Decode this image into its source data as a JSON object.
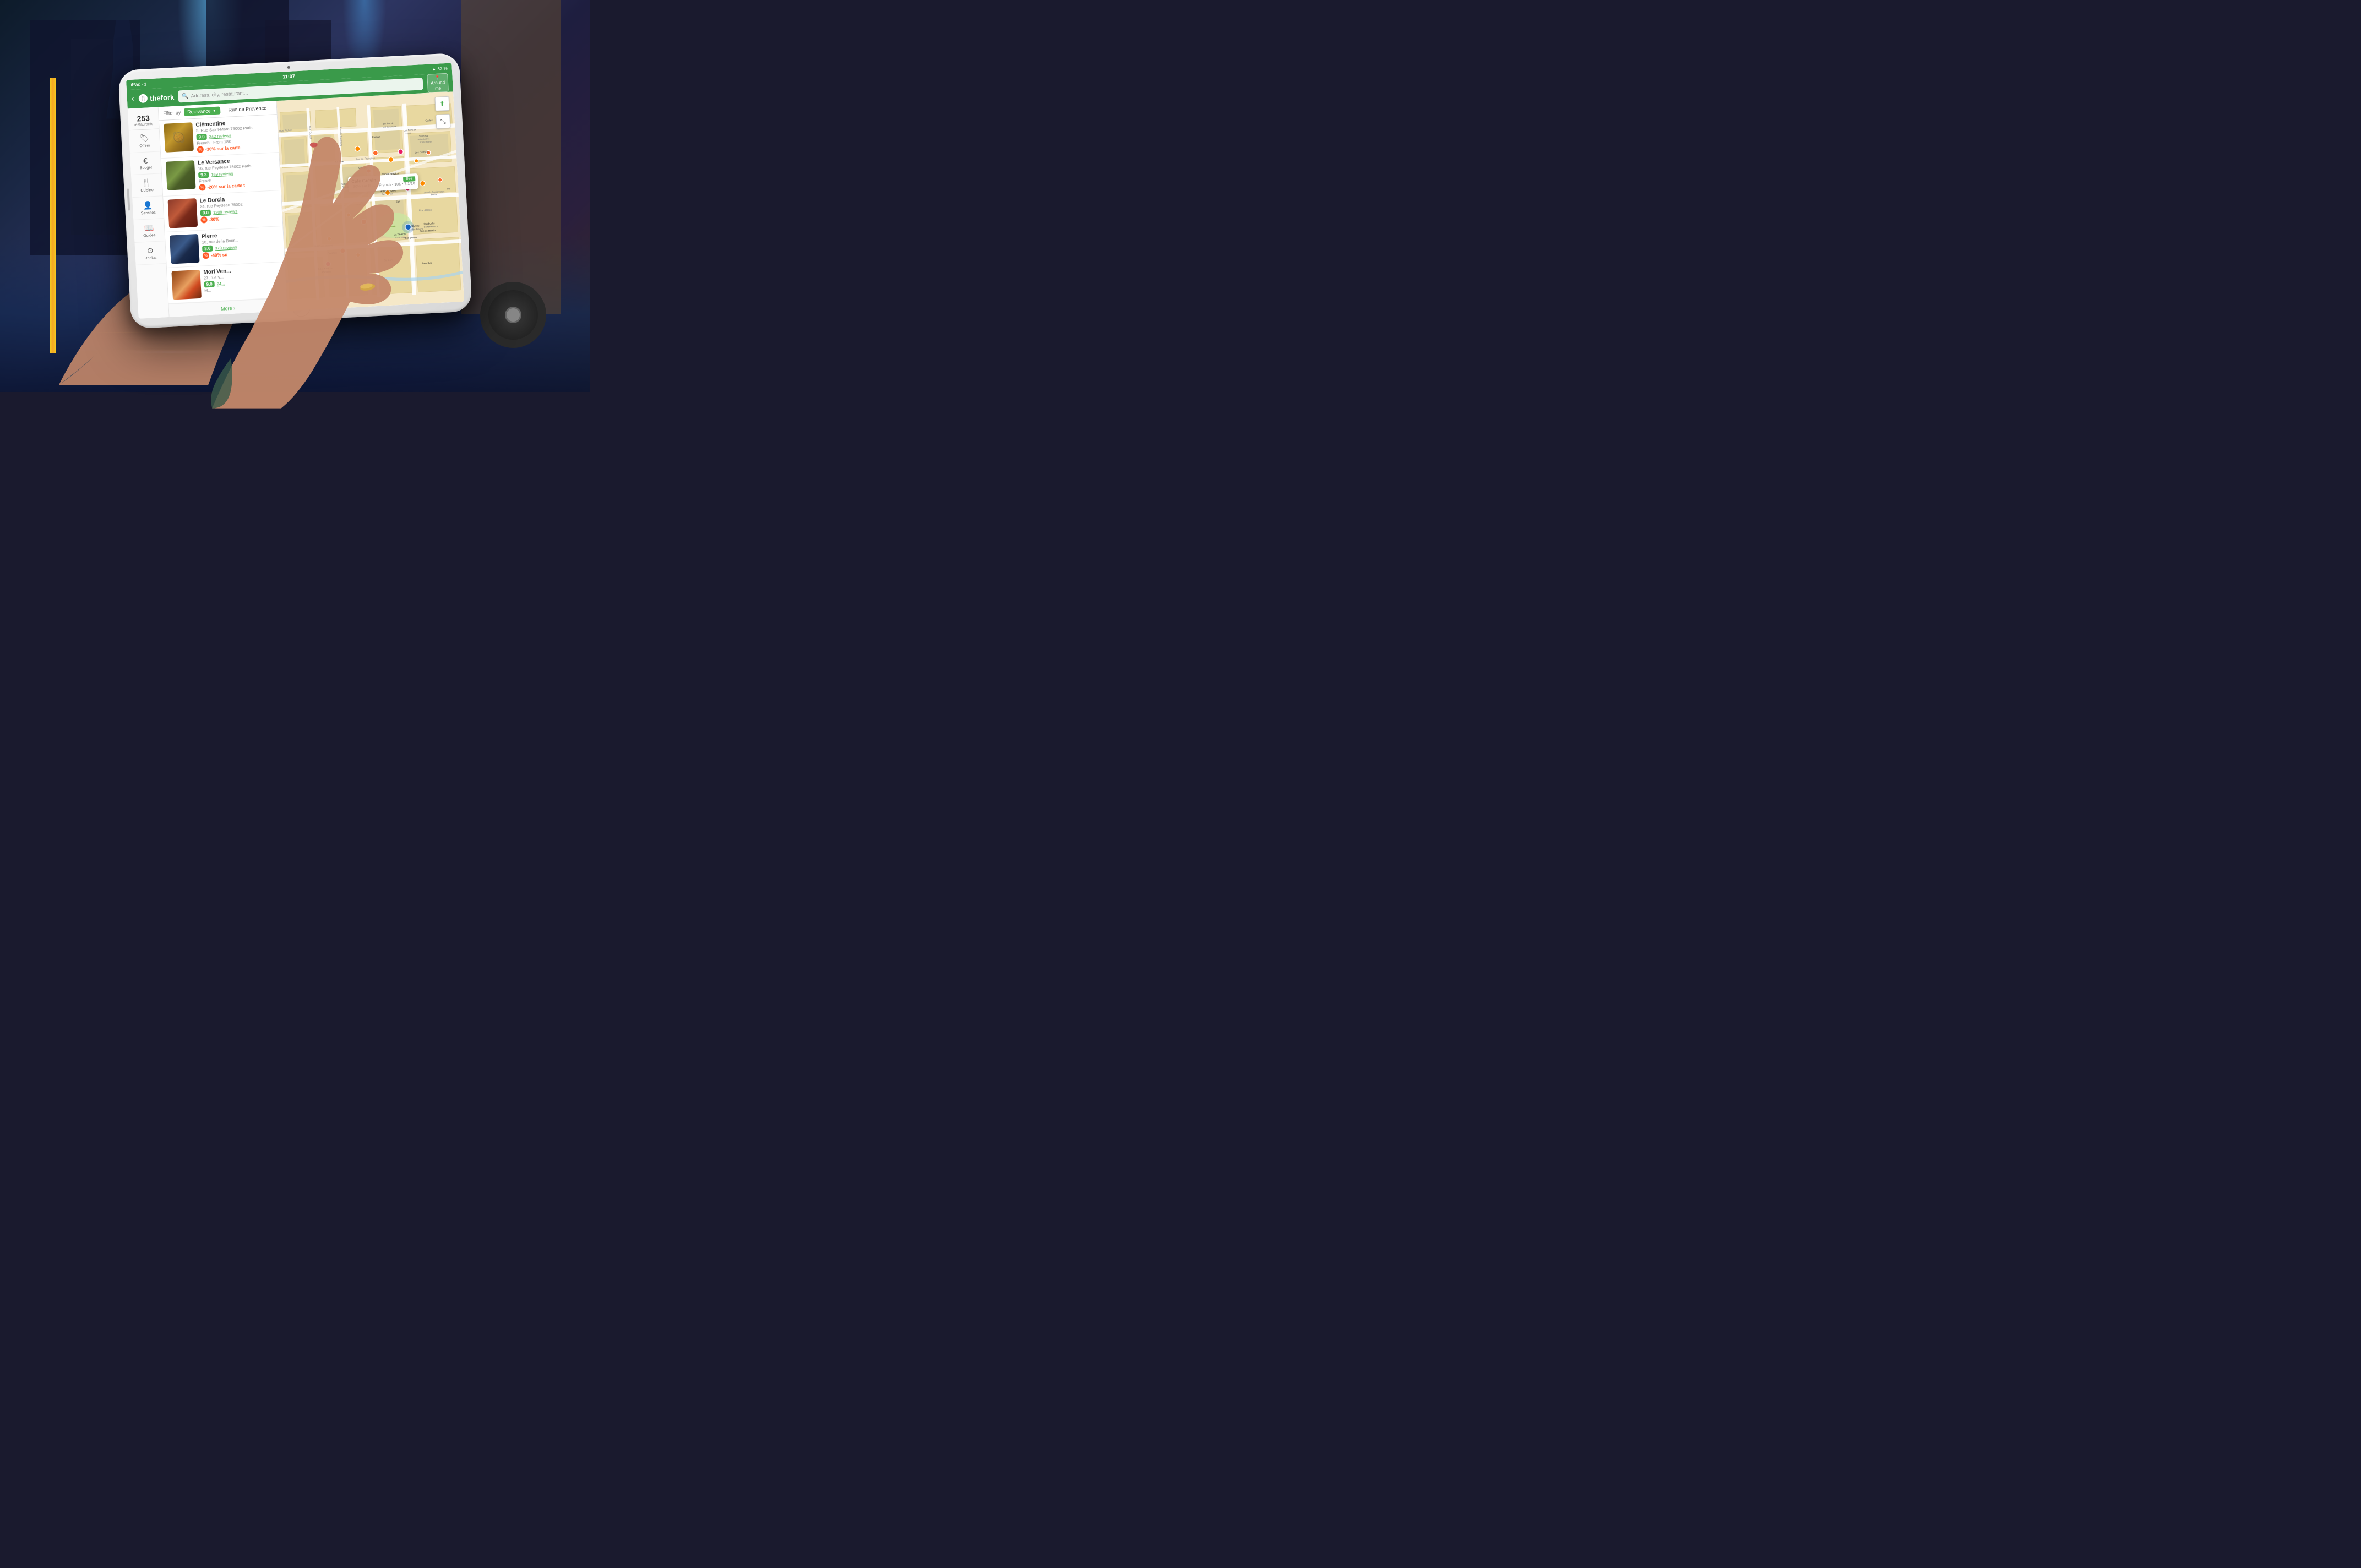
{
  "background": {
    "alt": "Night street scene with wet pavement and lights"
  },
  "tablet": {
    "model": "iPad",
    "status_bar": {
      "left": "iPad ◁",
      "time": "11:07",
      "right_icons": "▲ 52 %"
    },
    "header": {
      "back_label": "‹",
      "app_name": "thefork",
      "search_placeholder": "Address, city, restaurant...",
      "around_me_line1": "Around",
      "around_me_line2": "me"
    },
    "sidebar": {
      "count": "253",
      "count_label": "restaurants",
      "items": [
        {
          "id": "offers",
          "icon": "🏷",
          "label": "Offers"
        },
        {
          "id": "budget",
          "icon": "€",
          "label": "Budget"
        },
        {
          "id": "cuisine",
          "icon": "🍴",
          "label": "Cuisine"
        },
        {
          "id": "services",
          "icon": "👤",
          "label": "Services"
        },
        {
          "id": "guides",
          "icon": "📖",
          "label": "Guides"
        },
        {
          "id": "radius",
          "icon": "⊙",
          "label": "Radius"
        }
      ]
    },
    "filter": {
      "label": "Filter by",
      "dropdown_value": "Relevance",
      "street": "Rue de Provence"
    },
    "restaurants": [
      {
        "id": "clementine",
        "name": "Clémentine",
        "address": "5, Rue Saint-Marc 75002 Paris",
        "rating": "9.0",
        "reviews": "342 reviews",
        "cuisine": "French · From 18€",
        "discount": "-30% sur la carte",
        "image_type": "clementine"
      },
      {
        "id": "versace",
        "name": "Le Versance",
        "address": "16, rue Feydeau 75002 Paris",
        "rating": "9.3",
        "reviews": "169 reviews",
        "cuisine": "French",
        "discount": "-20% sur la carte t",
        "image_type": "versace"
      },
      {
        "id": "dorcia",
        "name": "Le Dorcia",
        "address": "24, rue Feydeau 75002",
        "rating": "9.0",
        "reviews": "1209 reviews",
        "cuisine": "",
        "discount": "-30%",
        "image_type": "dorcia"
      },
      {
        "id": "pierre",
        "name": "Pierre",
        "address": "10, rue de la Bour...",
        "rating": "8.6",
        "reviews": "370 reviews",
        "cuisine": "",
        "discount": "-40% su",
        "image_type": "pierre"
      },
      {
        "id": "mori",
        "name": "Mori Ven...",
        "address": "27, rue V...",
        "rating": "9.0",
        "reviews": "24...",
        "cuisine": "M...",
        "discount": "",
        "image_type": "mori"
      }
    ],
    "more_button": "More ›",
    "map": {
      "tooltip": {
        "title": "Café Grévin",
        "meta": "-30% sur la ... • French • 10€ • 7.1/10",
        "see_btn": "See"
      },
      "compass_icon": "⬆",
      "expand_icon": "⤡"
    }
  }
}
